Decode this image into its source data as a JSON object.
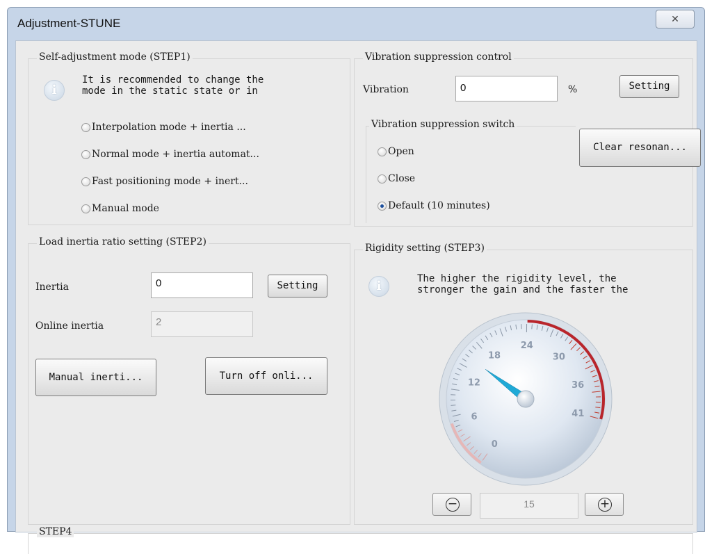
{
  "window": {
    "title": "Adjustment-STUNE",
    "close_glyph": "✕"
  },
  "step1": {
    "title": "Self-adjustment mode (STEP1)",
    "info_icon": "info-icon",
    "note_lines": [
      "It is recommended to change the",
      "mode in the static state or in"
    ],
    "modes": [
      {
        "label": "Interpolation mode + inertia ...",
        "selected": false
      },
      {
        "label": "Normal mode + inertia automat...",
        "selected": false
      },
      {
        "label": "Fast positioning mode + inert...",
        "selected": false
      },
      {
        "label": "Manual mode",
        "selected": false
      }
    ]
  },
  "vibration": {
    "title": "Vibration suppression control",
    "vibration_label": "Vibration",
    "vibration_value": "0",
    "unit": "%",
    "setting_button": "Setting",
    "switch_title": "Vibration suppression switch",
    "options": [
      {
        "label": "Open",
        "selected": false
      },
      {
        "label": "Close",
        "selected": false
      },
      {
        "label": "Default (10 minutes)",
        "selected": true
      }
    ],
    "clear_button": "Clear resonan..."
  },
  "step2": {
    "title": "Load inertia ratio setting (STEP2)",
    "inertia_label": "Inertia",
    "inertia_value": "0",
    "setting_button": "Setting",
    "online_label": "Online inertia",
    "online_value": "2",
    "manual_button": "Manual inerti...",
    "turnoff_button": "Turn off onli..."
  },
  "step3": {
    "title": "Rigidity setting (STEP3)",
    "info_icon": "info-icon",
    "note_lines": [
      "The higher the rigidity level, the",
      "stronger the gain and the faster the"
    ],
    "gauge": {
      "min": 0,
      "max": 41,
      "value": 15,
      "tick_labels": [
        "0",
        "6",
        "12",
        "18",
        "24",
        "30",
        "36",
        "41"
      ]
    },
    "value_display": "15",
    "minus_icon": "minus-circle-icon",
    "plus_icon": "plus-circle-icon"
  },
  "step4": {
    "title": "STEP4"
  }
}
